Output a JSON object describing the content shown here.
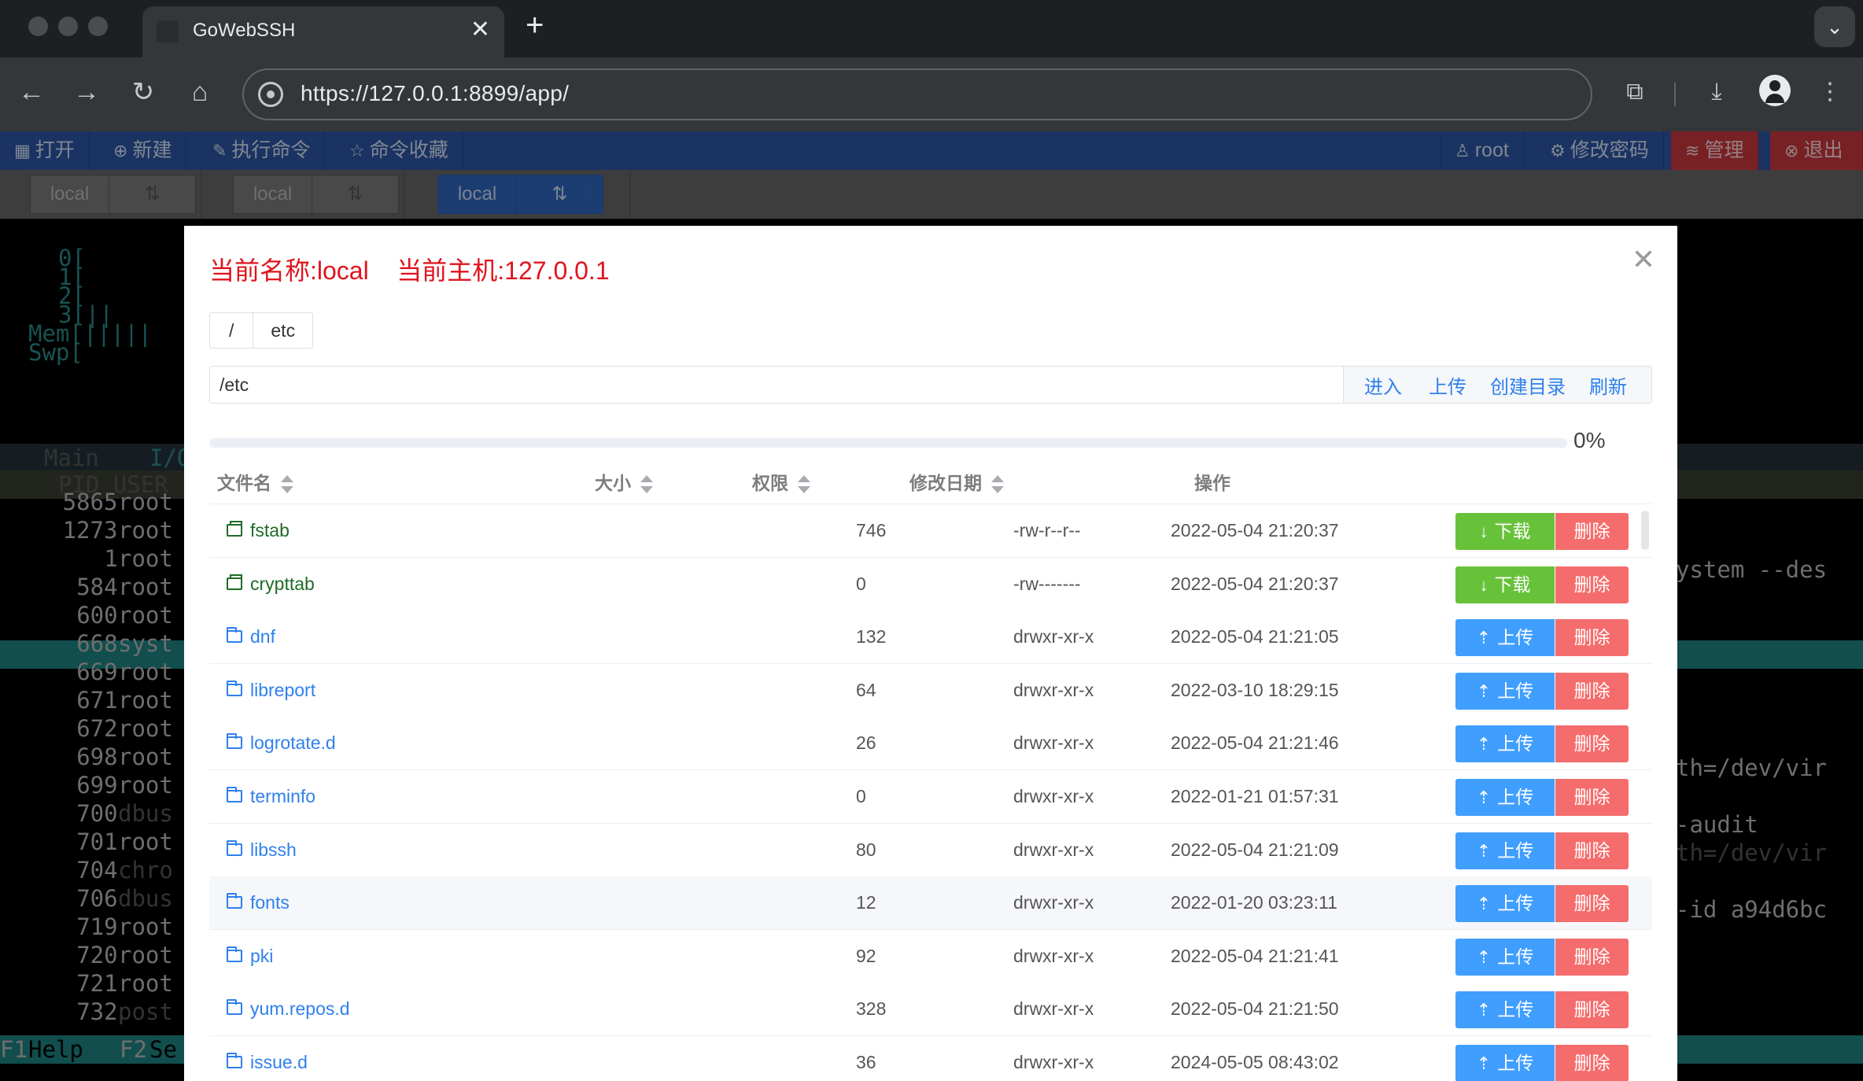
{
  "browser": {
    "tab_title": "GoWebSSH",
    "tab_close": "✕",
    "new_tab": "+",
    "tab_search": "⌄",
    "url": "https://127.0.0.1:8899/app/",
    "icons": [
      "back-icon",
      "forward-icon",
      "reload-icon",
      "home-icon",
      "site-info-icon",
      "extensions-icon",
      "download-icon",
      "profile-icon",
      "menu-icon"
    ]
  },
  "app_menu": {
    "open": "打开",
    "new": "新建",
    "exec": "执行命令",
    "favorites": "命令收藏",
    "user": "root",
    "change_password": "修改密码",
    "manage": "管理",
    "logout": "退出"
  },
  "sessions": [
    {
      "label": "local",
      "switch": "⇅",
      "active": false
    },
    {
      "label": "local",
      "switch": "⇅",
      "active": false
    },
    {
      "label": "local",
      "switch": "⇅",
      "active": true,
      "close": "✕"
    }
  ],
  "terminal": {
    "cpu_rows": [
      "0[",
      "1[",
      "2[",
      "3[||",
      "Mem[|||||",
      "Swp["
    ],
    "tabs": [
      "Main",
      "I/O"
    ],
    "header": "PID USER",
    "processes": [
      {
        "pid": "5865",
        "user": "root"
      },
      {
        "pid": "1273",
        "user": "root"
      },
      {
        "pid": "1",
        "user": "root"
      },
      {
        "pid": "584",
        "user": "root"
      },
      {
        "pid": "600",
        "user": "root"
      },
      {
        "pid": "668",
        "user": "syst"
      },
      {
        "pid": "669",
        "user": "root"
      },
      {
        "pid": "671",
        "user": "root"
      },
      {
        "pid": "672",
        "user": "root"
      },
      {
        "pid": "698",
        "user": "root"
      },
      {
        "pid": "699",
        "user": "root"
      },
      {
        "pid": "700",
        "user": "dbus"
      },
      {
        "pid": "701",
        "user": "root"
      },
      {
        "pid": "704",
        "user": "chro"
      },
      {
        "pid": "706",
        "user": "dbus"
      },
      {
        "pid": "719",
        "user": "root"
      },
      {
        "pid": "720",
        "user": "root"
      },
      {
        "pid": "721",
        "user": "root"
      },
      {
        "pid": "732",
        "user": "post"
      }
    ],
    "right_fragments": [
      "ystem --des",
      "th=/dev/vir",
      "-audit",
      "th=/dev/vir",
      "-id a94d6bc"
    ],
    "footer": [
      "F1",
      "Help",
      "F2",
      "Se"
    ]
  },
  "modal": {
    "title": "当前名称:local    当前主机:127.0.0.1",
    "close": "✕",
    "breadcrumbs": [
      "/",
      "etc"
    ],
    "path": "/etc",
    "actions": {
      "enter": "进入",
      "upload": "上传",
      "mkdir": "创建目录",
      "refresh": "刷新"
    },
    "progress_percent": 0,
    "progress_text": "0%",
    "columns": {
      "name": "文件名",
      "size": "大小",
      "perm": "权限",
      "date": "修改日期",
      "ops": "操作"
    },
    "buttons": {
      "download": "下载",
      "upload": "上传",
      "delete": "删除"
    },
    "files": [
      {
        "name": "fstab",
        "size": "746",
        "perm": "-rw-r--r--",
        "date": "2022-05-04 21:20:37",
        "type": "file"
      },
      {
        "name": "crypttab",
        "size": "0",
        "perm": "-rw-------",
        "date": "2022-05-04 21:20:37",
        "type": "file"
      },
      {
        "name": "dnf",
        "size": "132",
        "perm": "drwxr-xr-x",
        "date": "2022-05-04 21:21:05",
        "type": "dir"
      },
      {
        "name": "libreport",
        "size": "64",
        "perm": "drwxr-xr-x",
        "date": "2022-03-10 18:29:15",
        "type": "dir"
      },
      {
        "name": "logrotate.d",
        "size": "26",
        "perm": "drwxr-xr-x",
        "date": "2022-05-04 21:21:46",
        "type": "dir"
      },
      {
        "name": "terminfo",
        "size": "0",
        "perm": "drwxr-xr-x",
        "date": "2022-01-21 01:57:31",
        "type": "dir"
      },
      {
        "name": "libssh",
        "size": "80",
        "perm": "drwxr-xr-x",
        "date": "2022-05-04 21:21:09",
        "type": "dir"
      },
      {
        "name": "fonts",
        "size": "12",
        "perm": "drwxr-xr-x",
        "date": "2022-01-20 03:23:11",
        "type": "dir"
      },
      {
        "name": "pki",
        "size": "92",
        "perm": "drwxr-xr-x",
        "date": "2022-05-04 21:21:41",
        "type": "dir"
      },
      {
        "name": "yum.repos.d",
        "size": "328",
        "perm": "drwxr-xr-x",
        "date": "2022-05-04 21:21:50",
        "type": "dir"
      },
      {
        "name": "issue.d",
        "size": "36",
        "perm": "drwxr-xr-x",
        "date": "2024-05-05 08:43:02",
        "type": "dir"
      }
    ]
  },
  "colors": {
    "menu_bg": "#2c56a4",
    "title_red": "#e0131d",
    "link_blue": "#2f80ed",
    "download_green": "#67c23a",
    "upload_blue": "#409eff",
    "delete_red": "#f56c6c"
  }
}
